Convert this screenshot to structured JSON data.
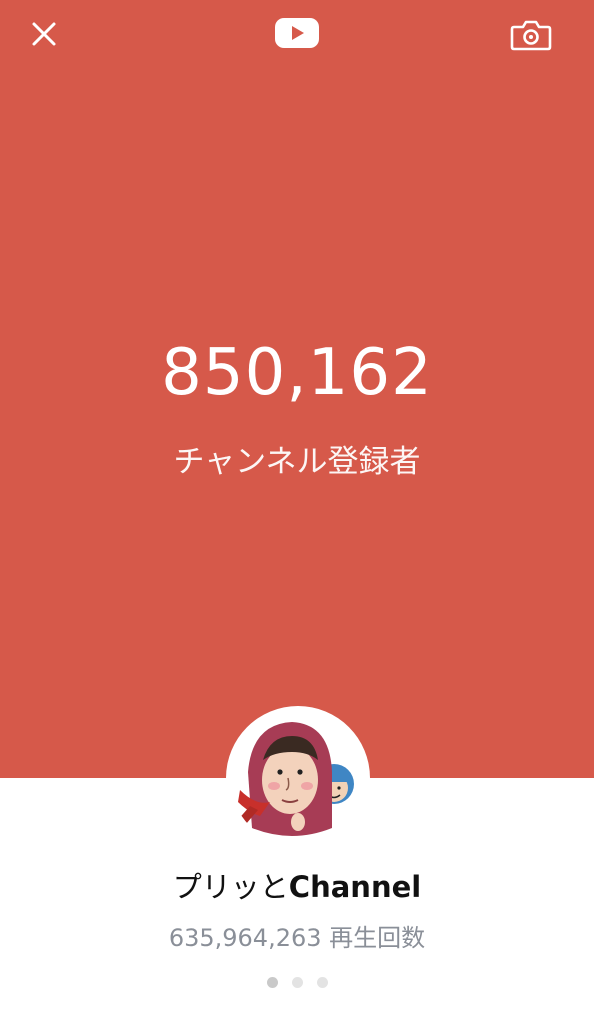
{
  "header": {
    "close_icon": "close-icon",
    "logo_icon": "youtube-logo-icon",
    "camera_icon": "camera-icon"
  },
  "stats": {
    "subscriber_count": "850,162",
    "subscriber_label": "チャンネル登録者"
  },
  "channel": {
    "name_jp": "プリッと",
    "name_latin": "Channel",
    "views_count": "635,964,263",
    "views_label": "再生回数"
  },
  "pager": {
    "total": 3,
    "active_index": 0
  },
  "colors": {
    "hero_bg": "#d6594a",
    "white": "#ffffff",
    "muted_text": "#8a8f98"
  }
}
